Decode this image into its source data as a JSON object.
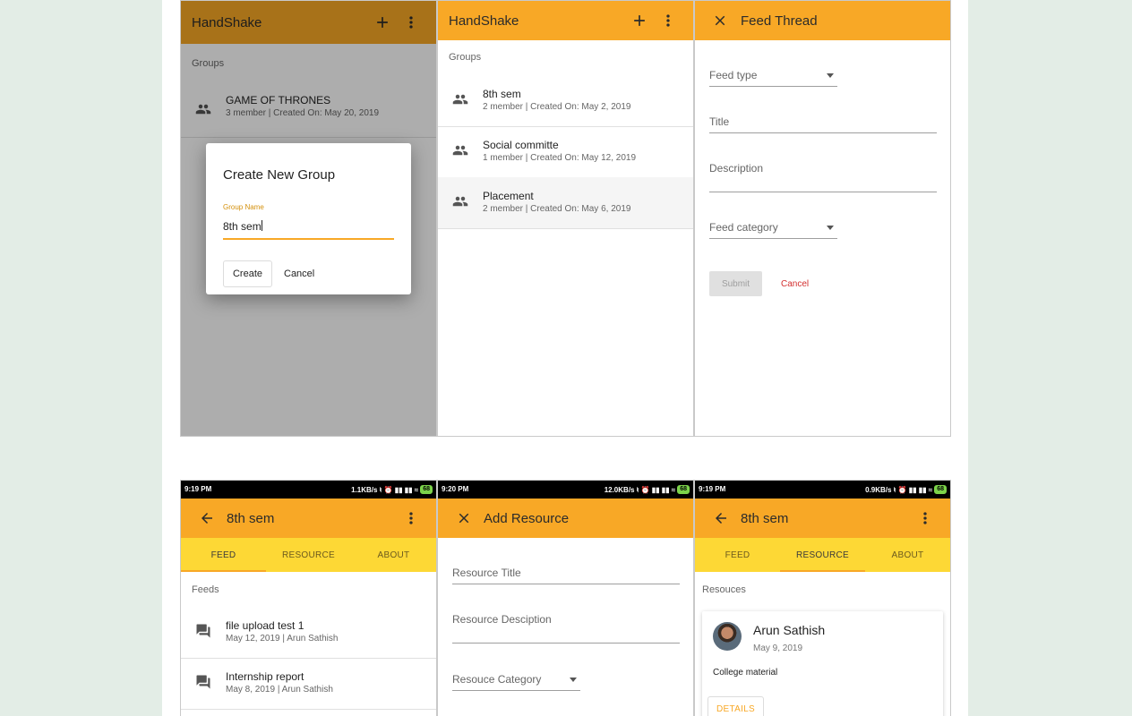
{
  "panel1": {
    "app_title": "HandShake",
    "groups_label": "Groups",
    "group": {
      "name": "GAME OF THRONES",
      "meta": "3 member | Created On: May 20, 2019"
    },
    "dialog": {
      "title": "Create New Group",
      "field_label": "Group Name",
      "field_value": "8th sem",
      "create_label": "Create",
      "cancel_label": "Cancel"
    }
  },
  "panel2": {
    "app_title": "HandShake",
    "groups_label": "Groups",
    "groups": [
      {
        "name": "8th sem",
        "meta": "2 member | Created On: May 2, 2019"
      },
      {
        "name": "Social committe",
        "meta": "1 member | Created On: May 12, 2019"
      },
      {
        "name": "Placement",
        "meta": "2 member | Created On: May 6, 2019"
      }
    ]
  },
  "panel3": {
    "title": "Feed Thread",
    "feed_type": "Feed type",
    "title_field": "Title",
    "description_field": "Description",
    "feed_category": "Feed category",
    "submit_label": "Submit",
    "cancel_label": "Cancel"
  },
  "panel4": {
    "status": {
      "time": "9:19 PM",
      "speed": "1.1KB/s",
      "battery": "68"
    },
    "title": "8th sem",
    "tabs": [
      "FEED",
      "RESOURCE",
      "ABOUT"
    ],
    "active_tab": "FEED",
    "feeds_label": "Feeds",
    "feeds": [
      {
        "title": "file upload test 1",
        "meta": "May 12, 2019 | Arun Sathish"
      },
      {
        "title": "Internship report",
        "meta": "May 8, 2019 | Arun Sathish"
      }
    ]
  },
  "panel5": {
    "status": {
      "time": "9:20 PM",
      "speed": "12.0KB/s",
      "battery": "68"
    },
    "title": "Add Resource",
    "resource_title": "Resource Title",
    "resource_description": "Resource Desciption",
    "resource_category": "Resouce Category"
  },
  "panel6": {
    "status": {
      "time": "9:19 PM",
      "speed": "0.9KB/s",
      "battery": "68"
    },
    "title": "8th sem",
    "tabs": [
      "FEED",
      "RESOURCE",
      "ABOUT"
    ],
    "active_tab": "RESOURCE",
    "resources_label": "Resouces",
    "card": {
      "author": "Arun Sathish",
      "date": "May 9, 2019",
      "body": "College material",
      "details_label": "DETAILS"
    }
  },
  "colors": {
    "app_bar": "#f8a826",
    "tab_bar": "#fdd835",
    "cancel_red": "#d32f2f"
  }
}
